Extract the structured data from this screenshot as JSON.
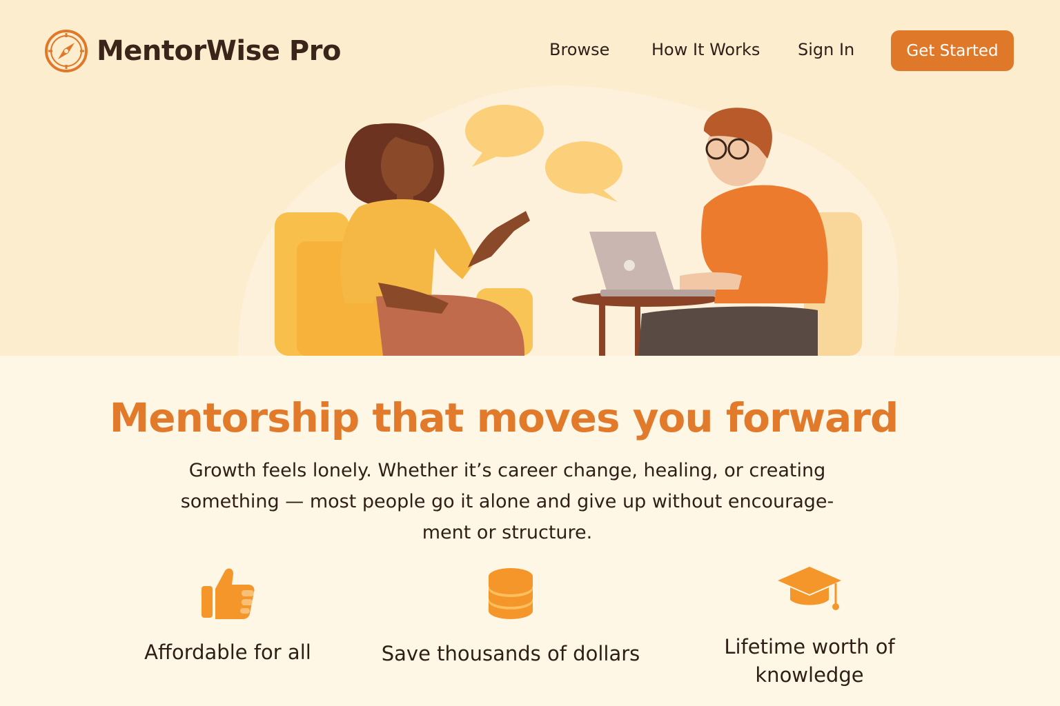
{
  "brand": {
    "name": "MentorWise Pro",
    "logo_icon": "compass-icon",
    "accent": "#e0782a"
  },
  "nav": {
    "browse": "Browse",
    "how_it_works": "How It Works",
    "sign_in": "Sign In",
    "get_started": "Get Started"
  },
  "hero": {
    "headline": "Mentorship that moves you forward",
    "subtitle": "Growth feels lonely. Whether it’s career change, healing, or creating something — most people go it alone and give up without encourage-ment or structure."
  },
  "features": [
    {
      "icon": "thumbs-up-icon",
      "label": "Affordable for all"
    },
    {
      "icon": "coin-stack-icon",
      "label": "Save thousands of dollars"
    },
    {
      "icon": "graduation-cap-icon",
      "label": "Lifetime worth of knowledge"
    }
  ]
}
